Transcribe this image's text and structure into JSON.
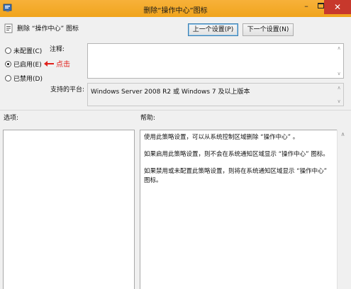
{
  "window": {
    "title": "删除“操作中心”图标",
    "minimize": "–",
    "close": "✕"
  },
  "header": {
    "policy_title": "删除 “操作中心” 图标"
  },
  "nav": {
    "prev_label": "上一个设置(P)",
    "next_label": "下一个设置(N)"
  },
  "state": {
    "options": [
      {
        "label": "未配置(C)",
        "checked": false
      },
      {
        "label": "已启用(E)",
        "checked": true
      },
      {
        "label": "已禁用(D)",
        "checked": false
      }
    ],
    "annotation": "点击"
  },
  "fields": {
    "comment_label": "注释:",
    "comment_value": "",
    "platform_label": "支持的平台:",
    "platform_value": "Windows Server 2008 R2 或 Windows 7 及以上版本"
  },
  "sections": {
    "options_label": "选项:",
    "help_label": "帮助:"
  },
  "help": {
    "paragraphs": [
      "使用此策略设置，可以从系统控制区域删除 “操作中心” 。",
      "如果启用此策略设置，则不会在系统通知区域显示 “操作中心” 图标。",
      "如果禁用或未配置此策略设置，则将在系统通知区域显示 “操作中心” 图标。"
    ]
  },
  "colors": {
    "titlebar": "#f0a41c",
    "close_button": "#c7382c",
    "annotation": "#e0201b"
  },
  "icons": {
    "app": "policy-app-icon",
    "policy": "policy-doc-icon"
  }
}
